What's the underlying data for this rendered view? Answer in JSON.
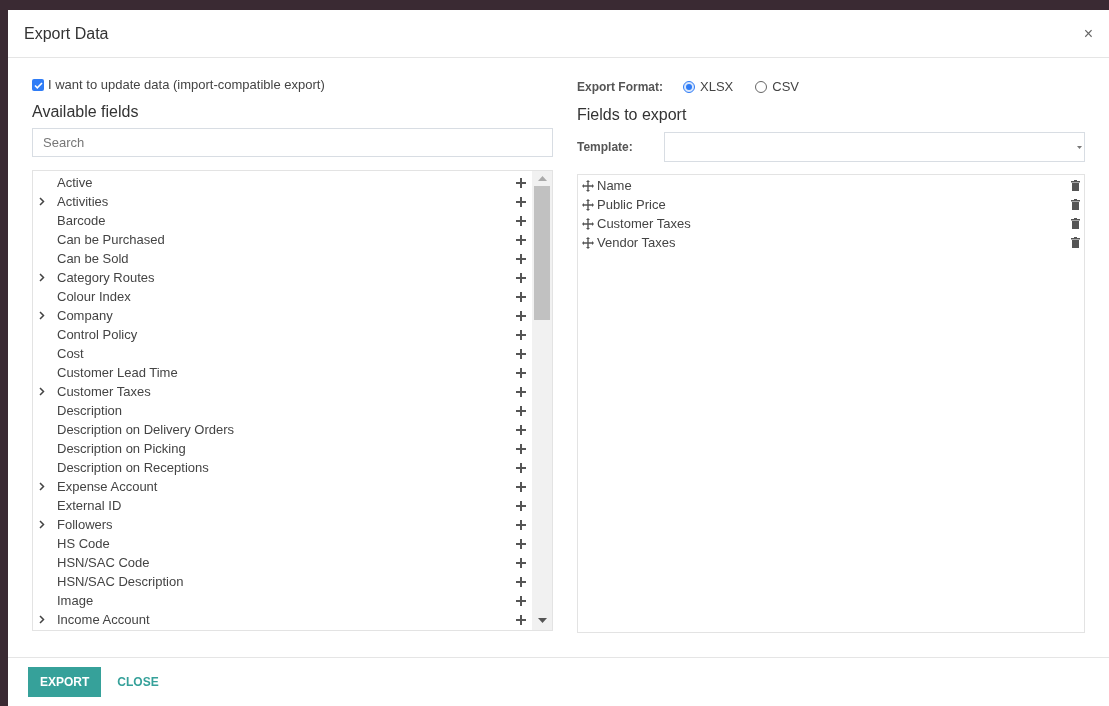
{
  "dialog": {
    "title": "Export Data",
    "close": "×"
  },
  "import_compatible": {
    "label": "I want to update data (import-compatible export)",
    "checked": true
  },
  "available": {
    "heading": "Available fields",
    "search_placeholder": "Search",
    "fields": [
      {
        "label": "Active",
        "expandable": false
      },
      {
        "label": "Activities",
        "expandable": true
      },
      {
        "label": "Barcode",
        "expandable": false
      },
      {
        "label": "Can be Purchased",
        "expandable": false
      },
      {
        "label": "Can be Sold",
        "expandable": false
      },
      {
        "label": "Category Routes",
        "expandable": true
      },
      {
        "label": "Colour Index",
        "expandable": false
      },
      {
        "label": "Company",
        "expandable": true
      },
      {
        "label": "Control Policy",
        "expandable": false
      },
      {
        "label": "Cost",
        "expandable": false
      },
      {
        "label": "Customer Lead Time",
        "expandable": false
      },
      {
        "label": "Customer Taxes",
        "expandable": true
      },
      {
        "label": "Description",
        "expandable": false
      },
      {
        "label": "Description on Delivery Orders",
        "expandable": false
      },
      {
        "label": "Description on Picking",
        "expandable": false
      },
      {
        "label": "Description on Receptions",
        "expandable": false
      },
      {
        "label": "Expense Account",
        "expandable": true
      },
      {
        "label": "External ID",
        "expandable": false
      },
      {
        "label": "Followers",
        "expandable": true
      },
      {
        "label": "HS Code",
        "expandable": false
      },
      {
        "label": "HSN/SAC Code",
        "expandable": false
      },
      {
        "label": "HSN/SAC Description",
        "expandable": false
      },
      {
        "label": "Image",
        "expandable": false
      },
      {
        "label": "Income Account",
        "expandable": true
      }
    ]
  },
  "export_format": {
    "label": "Export Format:",
    "options": [
      {
        "label": "XLSX",
        "selected": true
      },
      {
        "label": "CSV",
        "selected": false
      }
    ]
  },
  "to_export": {
    "heading": "Fields to export",
    "template_label": "Template:",
    "fields": [
      "Name",
      "Public Price",
      "Customer Taxes",
      "Vendor Taxes"
    ]
  },
  "buttons": {
    "export": "EXPORT",
    "close": "CLOSE"
  }
}
